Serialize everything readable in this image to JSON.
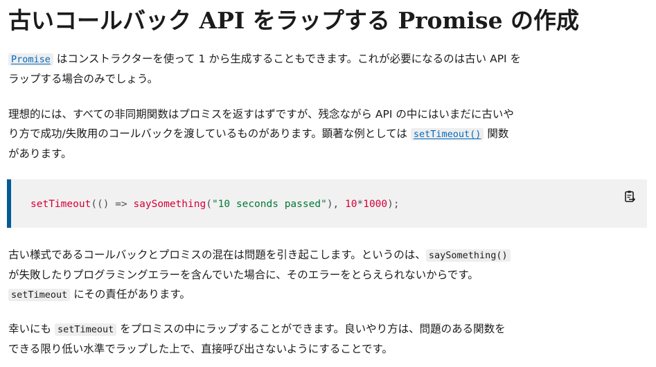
{
  "title": "古いコールバック API をラップする Promise の作成",
  "para1": {
    "link": "Promise",
    "line1": " はコンストラクターを使って 1 から生成することもできます。これが必要になるのは古い API を",
    "line2": "ラップする場合のみでしょう。"
  },
  "para2": {
    "line1": "理想的には、すべての非同期関数はプロミスを返すはずですが、残念ながら API の中にはいまだに古いや",
    "line2_before": "り方で成功/失敗用のコールバックを渡しているものがあります。顕著な例としては ",
    "link": "setTimeout()",
    "line2_after": " 関数",
    "line3": "があります。"
  },
  "code": {
    "fn1": "setTimeout",
    "p1": "(() ",
    "arrow": "=>",
    "sp": " ",
    "fn2": "saySomething",
    "p2": "(",
    "str": "\"10 seconds passed\"",
    "p3": "), ",
    "n1": "10",
    "op": "*",
    "n2": "1000",
    "p4": ");"
  },
  "para3": {
    "line1_before": "古い様式であるコールバックとプロミスの混在は問題を引き起こします。というのは、",
    "code1": "saySomething()",
    "line2": "が失敗したりプログラミングエラーを含んでいた場合に、そのエラーをとらえられないからです。",
    "code2": "setTimeout",
    "line3_after": " にその責任があります。"
  },
  "para4": {
    "line1_before": "幸いにも ",
    "code1": "setTimeout",
    "line1_after": " をプロミスの中にラップすることができます。良いやり方は、問題のある関数を",
    "line2": "できる限り低い水準でラップした上で、直接呼び出さないようにすることです。"
  },
  "icons": {
    "copy": "clipboard-copy-icon"
  },
  "colors": {
    "link": "#0069c2",
    "code_border": "#005b96",
    "code_bg": "#f2f1f1",
    "token_function": "#d30038",
    "token_string": "#007936"
  }
}
